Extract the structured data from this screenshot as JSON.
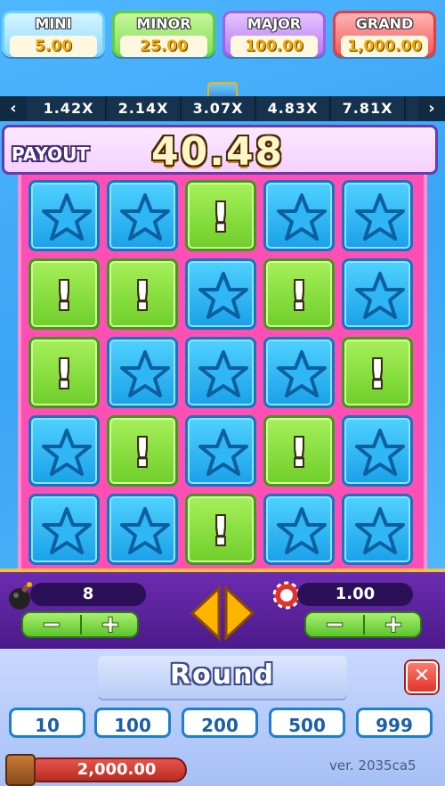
{
  "jackpots": [
    {
      "name": "MINI",
      "value": "5.00"
    },
    {
      "name": "MINOR",
      "value": "25.00"
    },
    {
      "name": "MAJOR",
      "value": "100.00"
    },
    {
      "name": "GRAND",
      "value": "1,000.00"
    }
  ],
  "multipliers": [
    "1.42X",
    "2.14X",
    "3.07X",
    "4.83X",
    "7.81X"
  ],
  "nav": {
    "prev": "‹",
    "next": "›"
  },
  "payout": {
    "label": "PAYOUT",
    "value": "40.48"
  },
  "grid": [
    [
      "star",
      "warn",
      "warn",
      "star",
      "star"
    ],
    [
      "star",
      "warn",
      "star",
      "warn",
      "star"
    ],
    [
      "warn",
      "star",
      "star",
      "star",
      "warn"
    ],
    [
      "star",
      "warn",
      "star",
      "warn",
      "star"
    ],
    [
      "star",
      "star",
      "warn",
      "star",
      "star"
    ]
  ],
  "grid_note": "column-major layout: grid[c][r]",
  "controls": {
    "mines": "8",
    "bet": "1.00",
    "minus": "−",
    "plus": "+"
  },
  "round": {
    "title": "Round",
    "options": [
      "10",
      "100",
      "200",
      "500",
      "999"
    ],
    "close": "✕"
  },
  "balance": "2,000.00",
  "version": "ver. 2035ca5",
  "colors": {
    "star_tile": "#1aa0e8",
    "warn_tile": "#6fce2a",
    "board_bg": "#ff4fb4",
    "controls_bg": "#5a22a0"
  }
}
